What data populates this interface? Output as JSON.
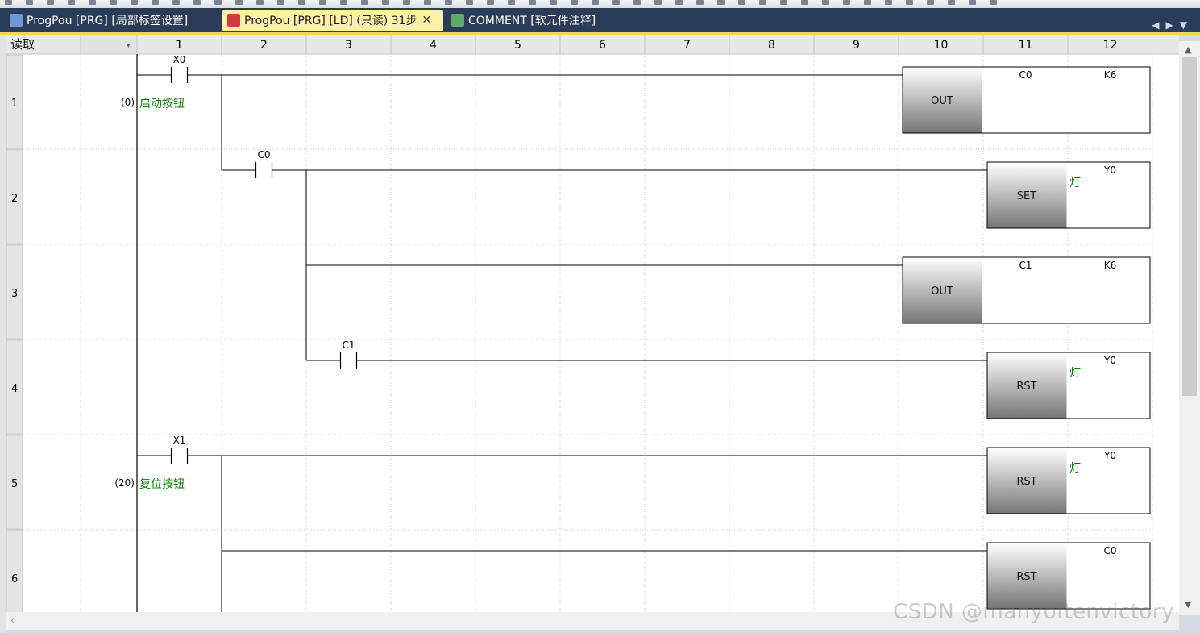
{
  "tabs": [
    {
      "label": "ProgPou [PRG] [局部标签设置]",
      "icon": "label-table-icon",
      "active": false,
      "closable": false
    },
    {
      "label": "ProgPou [PRG] [LD] (只读) 31步",
      "icon": "ladder-diagram-icon",
      "active": true,
      "closable": true
    },
    {
      "label": "COMMENT [软元件注释]",
      "icon": "device-comment-icon",
      "active": false,
      "closable": false
    }
  ],
  "tab_nav_icons": [
    "scroll-left-icon",
    "scroll-right-icon",
    "tab-menu-icon"
  ],
  "mode_label": "读取",
  "column_headers": [
    "1",
    "2",
    "3",
    "4",
    "5",
    "6",
    "7",
    "8",
    "9",
    "10",
    "11",
    "12"
  ],
  "row_numbers": [
    "1",
    "2",
    "3",
    "4",
    "5",
    "6"
  ],
  "step_labels": [
    {
      "row": 1,
      "text": "(0)"
    },
    {
      "row": 5,
      "text": "(20)"
    }
  ],
  "contacts": [
    {
      "row": 1,
      "col": 1,
      "device": "X0",
      "comment": "启动按钮"
    },
    {
      "row": 2,
      "col": 2,
      "device": "C0",
      "comment": ""
    },
    {
      "row": 4,
      "col": 3,
      "device": "C1",
      "comment": ""
    },
    {
      "row": 5,
      "col": 1,
      "device": "X1",
      "comment": "复位按钮"
    }
  ],
  "instructions": [
    {
      "row": 1,
      "type": "counter",
      "name": "OUT",
      "operand": "C0",
      "setting": "K6",
      "comment": ""
    },
    {
      "row": 2,
      "type": "coil",
      "name": "SET",
      "operand": "Y0",
      "setting": "",
      "comment": "灯"
    },
    {
      "row": 3,
      "type": "counter",
      "name": "OUT",
      "operand": "C1",
      "setting": "K6",
      "comment": ""
    },
    {
      "row": 4,
      "type": "coil",
      "name": "RST",
      "operand": "Y0",
      "setting": "",
      "comment": "灯"
    },
    {
      "row": 5,
      "type": "coil",
      "name": "RST",
      "operand": "Y0",
      "setting": "",
      "comment": "灯"
    },
    {
      "row": 6,
      "type": "coil",
      "name": "RST",
      "operand": "C0",
      "setting": "",
      "comment": ""
    }
  ],
  "watermark": "CSDN @manyoftenvictory",
  "colors": {
    "tab_bar": "#2b3c59",
    "active_tab": "#fff2a8",
    "comment_text": "#008000",
    "rung_line": "#000000",
    "grid_dots": "#c8c8c8"
  }
}
